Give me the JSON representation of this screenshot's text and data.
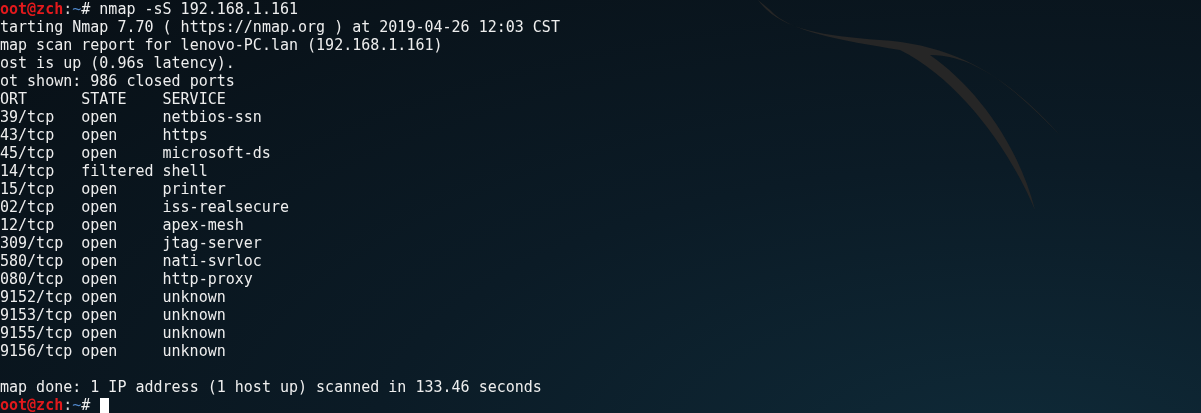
{
  "terminal": {
    "lines": [
      {
        "kind": "prompt",
        "segments": [
          {
            "kind": "host",
            "text": "oot@zch"
          },
          {
            "kind": "sep",
            "text": ":"
          },
          {
            "kind": "path",
            "text": "~"
          },
          {
            "kind": "symbol",
            "text": "#"
          }
        ],
        "command": "nmap -sS 192.168.1.161",
        "cursor": false
      },
      {
        "kind": "output",
        "text": "tarting Nmap 7.70 ( https://nmap.org ) at 2019-04-26 12:03 CST"
      },
      {
        "kind": "output",
        "text": "map scan report for lenovo-PC.lan (192.168.1.161)"
      },
      {
        "kind": "output",
        "text": "ost is up (0.96s latency)."
      },
      {
        "kind": "output",
        "text": "ot shown: 986 closed ports"
      },
      {
        "kind": "ports",
        "header": {
          "port": "ORT",
          "state": "STATE",
          "service": "SERVICE"
        },
        "rows": [
          {
            "port": "39/tcp",
            "state": "open",
            "service": "netbios-ssn"
          },
          {
            "port": "43/tcp",
            "state": "open",
            "service": "https"
          },
          {
            "port": "45/tcp",
            "state": "open",
            "service": "microsoft-ds"
          },
          {
            "port": "14/tcp",
            "state": "filtered",
            "service": "shell"
          },
          {
            "port": "15/tcp",
            "state": "open",
            "service": "printer"
          },
          {
            "port": "02/tcp",
            "state": "open",
            "service": "iss-realsecure"
          },
          {
            "port": "12/tcp",
            "state": "open",
            "service": "apex-mesh"
          },
          {
            "port": "309/tcp",
            "state": "open",
            "service": "jtag-server"
          },
          {
            "port": "580/tcp",
            "state": "open",
            "service": "nati-svrloc"
          },
          {
            "port": "080/tcp",
            "state": "open",
            "service": "http-proxy"
          },
          {
            "port": "9152/tcp",
            "state": "open",
            "service": "unknown"
          },
          {
            "port": "9153/tcp",
            "state": "open",
            "service": "unknown"
          },
          {
            "port": "9155/tcp",
            "state": "open",
            "service": "unknown"
          },
          {
            "port": "9156/tcp",
            "state": "open",
            "service": "unknown"
          }
        ]
      },
      {
        "kind": "blank"
      },
      {
        "kind": "output",
        "text": "map done: 1 IP address (1 host up) scanned in 133.46 seconds"
      },
      {
        "kind": "prompt",
        "segments": [
          {
            "kind": "host",
            "text": "oot@zch"
          },
          {
            "kind": "sep",
            "text": ":"
          },
          {
            "kind": "path",
            "text": "~"
          },
          {
            "kind": "symbol",
            "text": "#"
          }
        ],
        "cursor": true
      }
    ]
  }
}
